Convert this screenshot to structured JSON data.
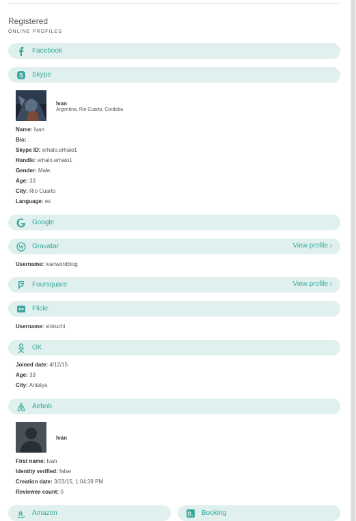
{
  "header": {
    "status": "Registered",
    "section_title": "ONLINE PROFILES"
  },
  "colors": {
    "accent": "#39a89a",
    "pill_bg": "#dff0ee"
  },
  "profiles": {
    "facebook": {
      "label": "Facebook",
      "icon": "facebook-icon"
    },
    "skype": {
      "label": "Skype",
      "icon": "skype-icon",
      "display_name": "Ivan",
      "location": "Argentina, Rio Cuarto, Cordoba",
      "fields": [
        {
          "key": "Name:",
          "value": "Ivan"
        },
        {
          "key": "Bio:",
          "value": "."
        },
        {
          "key": "Skype ID:",
          "value": "erhalo.erhalo1"
        },
        {
          "key": "Handle:",
          "value": "erhalo.erhalo1"
        },
        {
          "key": "Gender:",
          "value": "Male"
        },
        {
          "key": "Age:",
          "value": "33"
        },
        {
          "key": "City:",
          "value": "Rio Cuarto"
        },
        {
          "key": "Language:",
          "value": "es"
        }
      ]
    },
    "google": {
      "label": "Google",
      "icon": "google-icon"
    },
    "gravatar": {
      "label": "Gravatar",
      "icon": "wordpress-icon",
      "link": "View profile ›",
      "fields": [
        {
          "key": "Username:",
          "value": "ivanwordblog"
        }
      ]
    },
    "foursquare": {
      "label": "Foursquare",
      "icon": "foursquare-icon",
      "link": "View profile ›"
    },
    "flickr": {
      "label": "Flickr",
      "icon": "flickr-icon",
      "fields": [
        {
          "key": "Username:",
          "value": "sinkuchi"
        }
      ]
    },
    "ok": {
      "label": "OK",
      "icon": "odnoklassniki-icon",
      "fields": [
        {
          "key": "Joined date:",
          "value": "4/12/15"
        },
        {
          "key": "Age:",
          "value": "33"
        },
        {
          "key": "City:",
          "value": "Antalya"
        }
      ]
    },
    "airbnb": {
      "label": "Airbnb",
      "icon": "airbnb-icon",
      "display_name": "Ivan",
      "fields": [
        {
          "key": "First name:",
          "value": "Ivan"
        },
        {
          "key": "Identity verified:",
          "value": "false"
        },
        {
          "key": "Creation date:",
          "value": "3/23/15, 1:04:39 PM"
        },
        {
          "key": "Reviewee count:",
          "value": "0"
        }
      ]
    },
    "amazon": {
      "label": "Amazon",
      "icon": "amazon-icon"
    },
    "booking": {
      "label": "Booking",
      "icon": "booking-icon"
    }
  }
}
